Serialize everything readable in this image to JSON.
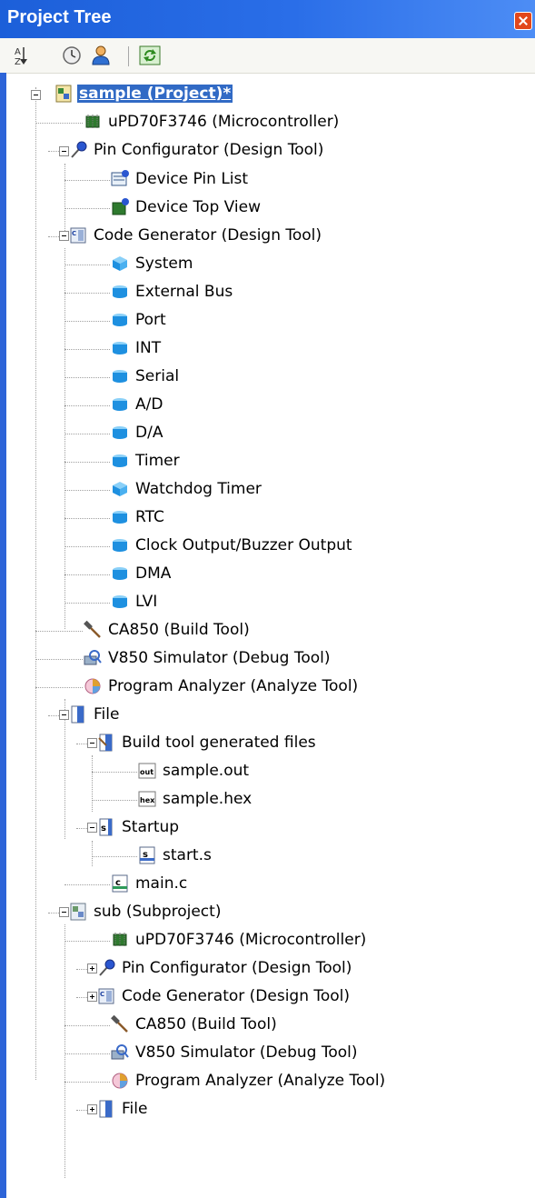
{
  "panel": {
    "title": "Project Tree",
    "toolbar": {
      "buttons": [
        {
          "name": "sort-az-icon"
        },
        {
          "name": "clock-icon"
        },
        {
          "name": "user-icon"
        },
        {
          "name": "refresh-icon"
        }
      ]
    }
  },
  "tree": {
    "root": "sample (Project)*",
    "items": [
      {
        "label": "uPD70F3746 (Microcontroller)",
        "icon": "chip-icon"
      },
      {
        "label": "Pin Configurator (Design Tool)",
        "icon": "pin-tool-icon"
      },
      {
        "label": "Device Pin List",
        "icon": "pin-list-icon"
      },
      {
        "label": "Device Top View",
        "icon": "top-view-icon"
      },
      {
        "label": "Code Generator (Design Tool)",
        "icon": "code-generator-icon"
      },
      {
        "label": "System",
        "icon": "cube-icon"
      },
      {
        "label": "External Bus",
        "icon": "cube-icon"
      },
      {
        "label": "Port",
        "icon": "cube-icon"
      },
      {
        "label": "INT",
        "icon": "cube-icon"
      },
      {
        "label": "Serial",
        "icon": "cube-icon"
      },
      {
        "label": "A/D",
        "icon": "cube-icon"
      },
      {
        "label": "D/A",
        "icon": "cube-icon"
      },
      {
        "label": "Timer",
        "icon": "cube-icon"
      },
      {
        "label": "Watchdog Timer",
        "icon": "cube-icon"
      },
      {
        "label": "RTC",
        "icon": "cube-icon"
      },
      {
        "label": "Clock Output/Buzzer Output",
        "icon": "cube-icon"
      },
      {
        "label": "DMA",
        "icon": "cube-icon"
      },
      {
        "label": "LVI",
        "icon": "cube-icon"
      },
      {
        "label": "CA850 (Build Tool)",
        "icon": "hammer-icon"
      },
      {
        "label": "V850 Simulator (Debug Tool)",
        "icon": "debug-icon"
      },
      {
        "label": "Program Analyzer (Analyze Tool)",
        "icon": "analyzer-icon"
      },
      {
        "label": "File",
        "icon": "folder-icon"
      },
      {
        "label": "Build tool generated files",
        "icon": "folder-build-icon"
      },
      {
        "label": "sample.out",
        "icon": "out-file-icon"
      },
      {
        "label": "sample.hex",
        "icon": "hex-file-icon"
      },
      {
        "label": "Startup",
        "icon": "folder-s-icon"
      },
      {
        "label": "start.s",
        "icon": "s-file-icon"
      },
      {
        "label": "main.c",
        "icon": "c-file-icon"
      },
      {
        "label": "sub (Subproject)",
        "icon": "subproject-icon"
      },
      {
        "label": "uPD70F3746 (Microcontroller)",
        "icon": "chip-icon"
      },
      {
        "label": "Pin Configurator (Design Tool)",
        "icon": "pin-tool-icon"
      },
      {
        "label": "Code Generator (Design Tool)",
        "icon": "code-generator-icon"
      },
      {
        "label": "CA850 (Build Tool)",
        "icon": "hammer-icon"
      },
      {
        "label": "V850 Simulator (Debug Tool)",
        "icon": "debug-icon"
      },
      {
        "label": "Program Analyzer (Analyze Tool)",
        "icon": "analyzer-icon"
      },
      {
        "label": "File",
        "icon": "folder-icon"
      }
    ]
  }
}
